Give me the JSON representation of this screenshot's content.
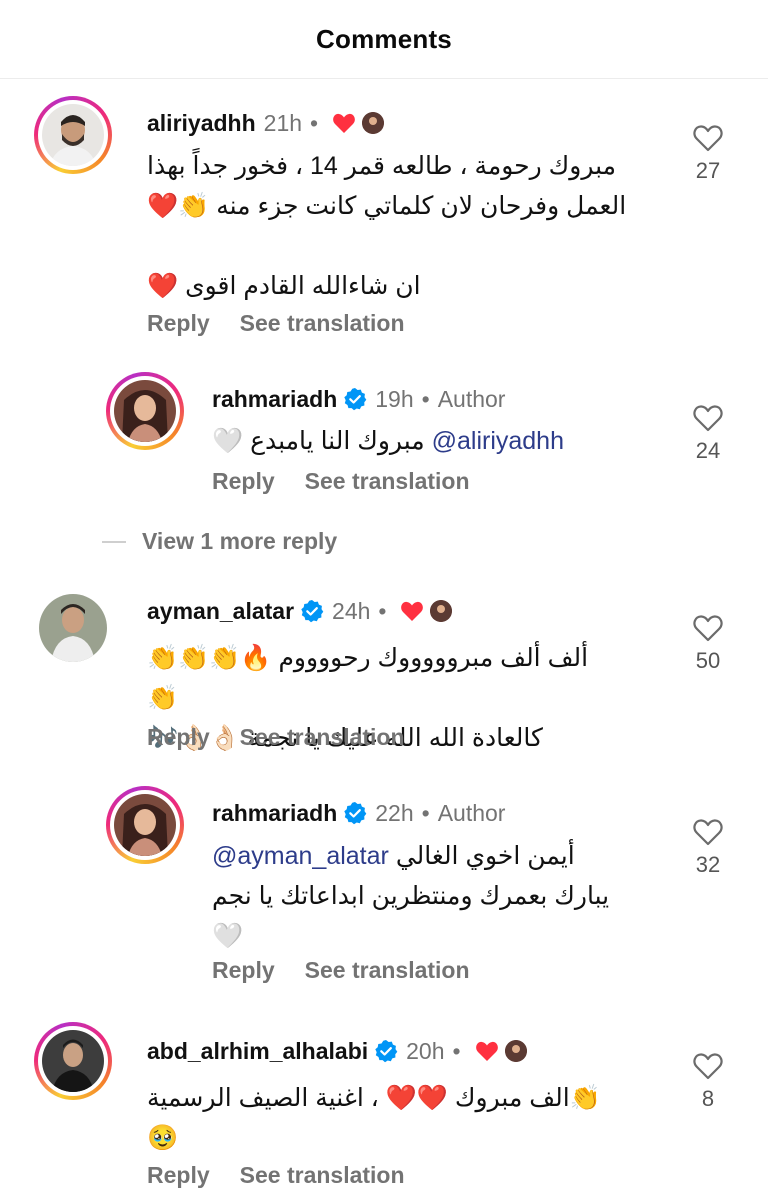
{
  "header": {
    "title": "Comments"
  },
  "comments": [
    {
      "username": "aliriyadhh",
      "time": "21h",
      "lines": [
        "مبروك رحومة ، طالعه قمر 14 ، فخور جداً بهذا",
        "العمل وفرحان لان كلماتي كانت جزء منه 👏❤️",
        "",
        "ان شاءالله القادم اقوى ❤️"
      ],
      "reply_label": "Reply",
      "translate_label": "See translation",
      "likes": "27"
    },
    {
      "username": "rahmariadh",
      "time": "19h",
      "author_badge": "Author",
      "mention": "@aliriyadhh",
      "lines": [
        "مبروك النا يامبدع 🤍"
      ],
      "reply_label": "Reply",
      "translate_label": "See translation",
      "likes": "24"
    },
    {
      "username": "ayman_alatar",
      "time": "24h",
      "lines": [
        "ألف ألف مبروووووك رحووووم 🔥👏👏👏👏",
        "كالعادة الله الله عليك يا نجمة 👌🏻👌🏻🎶"
      ],
      "reply_label": "Reply",
      "translate_label": "See translation",
      "likes": "50"
    },
    {
      "username": "rahmariadh",
      "time": "22h",
      "author_badge": "Author",
      "mention": "@ayman_alatar",
      "lines": [
        "أيمن اخوي الغالي",
        "يبارك بعمرك ومنتظرين ابداعاتك يا نجم",
        "🤍"
      ],
      "reply_label": "Reply",
      "translate_label": "See translation",
      "likes": "32"
    },
    {
      "username": "abd_alrhim_alhalabi",
      "time": "20h",
      "lines": [
        "👏الف مبروك ❤️❤️ ، اغنية الصيف الرسمية",
        "🥹"
      ],
      "reply_label": "Reply",
      "translate_label": "See translation",
      "likes": "8"
    }
  ],
  "view_more": "View 1 more reply",
  "icons": {
    "like": "heart-outline-icon",
    "verified": "verified-badge-icon",
    "creator_liked": "red-heart-icon"
  },
  "colors": {
    "verified_blue": "#0095f6",
    "heart_red": "#ff3040",
    "mention": "#2d3c8a",
    "secondary_text": "#737373"
  }
}
